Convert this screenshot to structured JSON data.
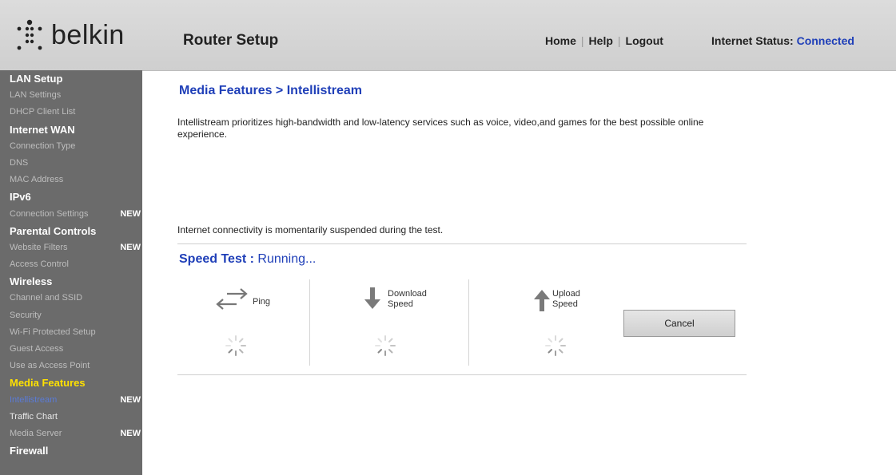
{
  "brand": {
    "name": "belkin"
  },
  "header": {
    "app_title": "Router Setup",
    "nav": [
      "Home",
      "Help",
      "Logout"
    ],
    "status_label": "Internet Status:",
    "status_value": "Connected",
    "status_color": "#1f3fb8"
  },
  "sidebar": {
    "new_label": "NEW",
    "items": [
      {
        "label": "LAN Setup",
        "type": "section"
      },
      {
        "label": "LAN Settings",
        "type": "item"
      },
      {
        "label": "DHCP Client List",
        "type": "item"
      },
      {
        "label": "Internet WAN",
        "type": "section"
      },
      {
        "label": "Connection Type",
        "type": "item"
      },
      {
        "label": "DNS",
        "type": "item"
      },
      {
        "label": "MAC Address",
        "type": "item"
      },
      {
        "label": "IPv6",
        "type": "section"
      },
      {
        "label": "Connection Settings",
        "type": "item",
        "new": true
      },
      {
        "label": "Parental Controls",
        "type": "section"
      },
      {
        "label": "Website Filters",
        "type": "item",
        "new": true
      },
      {
        "label": "Access Control",
        "type": "item"
      },
      {
        "label": "Wireless",
        "type": "section"
      },
      {
        "label": "Channel and SSID",
        "type": "item"
      },
      {
        "label": "Security",
        "type": "item"
      },
      {
        "label": "Wi-Fi Protected Setup",
        "type": "item"
      },
      {
        "label": "Guest Access",
        "type": "item"
      },
      {
        "label": "Use as Access Point",
        "type": "item"
      },
      {
        "label": "Media Features",
        "type": "media"
      },
      {
        "label": "Intellistream",
        "type": "item",
        "current": true,
        "new": true
      },
      {
        "label": "Traffic Chart",
        "type": "item",
        "light": true
      },
      {
        "label": "Media Server",
        "type": "item",
        "new": true
      },
      {
        "label": "Firewall",
        "type": "section"
      }
    ]
  },
  "main": {
    "title": "Media Features > Intellistream",
    "description": "Intellistream prioritizes high-bandwidth and low-latency services such as voice, video,and games for the best possible online experience.",
    "notice": "Internet connectivity is momentarily suspended during the test.",
    "speed_test_label": "Speed Test :",
    "speed_test_status": "Running...",
    "metrics": [
      {
        "label": "Ping",
        "icon": "ping-arrows-icon"
      },
      {
        "label": "Download Speed",
        "icon": "download-arrow-icon"
      },
      {
        "label": "Upload Speed",
        "icon": "upload-arrow-icon"
      }
    ],
    "cancel_label": "Cancel"
  }
}
